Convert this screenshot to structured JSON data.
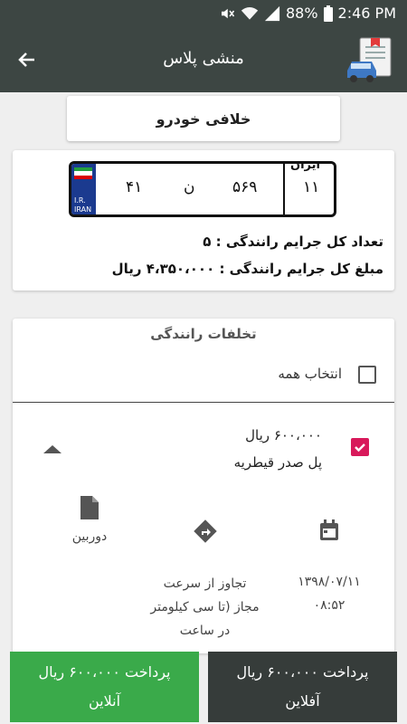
{
  "status": {
    "battery": "88%",
    "time": "2:46 PM"
  },
  "appbar": {
    "title": "منشی پلاس"
  },
  "tab": {
    "label": "خلافی خودرو"
  },
  "plate": {
    "left_num": "۴۱",
    "letter": "ن",
    "mid_num": "۵۶۹",
    "region": "۱۱",
    "country_word": "ایران",
    "band_line1": "I.R.",
    "band_line2": "IRAN"
  },
  "summary": {
    "count_line": "تعداد کل جرایم رانندگی : ۵",
    "amount_line": "مبلغ کل جرایم رانندگی : ۴،۳۵۰،۰۰۰ ریال"
  },
  "violations": {
    "title": "تخلفات رانندگی",
    "select_all": "انتخاب همه",
    "items": [
      {
        "amount": "۶۰۰،۰۰۰ ریال",
        "place": "پل صدر قیطریه",
        "date_time": "۱۳۹۸/۰۷/۱۱\n۰۸:۵۲",
        "type": "تجاوز از سرعت\nمجاز (تا سی کیلومتر\nدر ساعت",
        "source": "دوربین",
        "checked": true
      }
    ]
  },
  "buttons": {
    "online": "پرداخت ۶۰۰،۰۰۰ ریال\nآنلاین",
    "offline": "پرداخت ۶۰۰،۰۰۰ ریال\nآفلاین"
  },
  "colors": {
    "bar": "#3d4643",
    "accent": "#d8195b",
    "online": "#3aaa4a",
    "offline": "#363c3a"
  },
  "icons": [
    "mute-icon",
    "wifi-icon",
    "signal-icon",
    "battery-icon",
    "back-arrow-icon",
    "car-document-logo-icon",
    "checkbox-icon",
    "chevron-up-icon",
    "calendar-icon",
    "direction-icon",
    "document-icon"
  ]
}
